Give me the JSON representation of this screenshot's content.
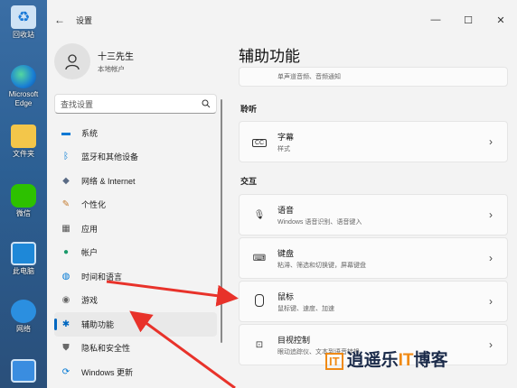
{
  "desktop": [
    {
      "label": "回收站",
      "icon": "recycle-bin-icon"
    },
    {
      "label": "Microsoft Edge",
      "icon": "edge-icon"
    },
    {
      "label": "文件夹",
      "icon": "folder-icon"
    },
    {
      "label": "微信",
      "icon": "wechat-icon"
    },
    {
      "label": "此电脑",
      "icon": "computer-icon"
    },
    {
      "label": "网络",
      "icon": "network-icon"
    }
  ],
  "window": {
    "back": "←",
    "title": "设置",
    "controls": [
      "—",
      "☐",
      "✕"
    ]
  },
  "user": {
    "name": "十三先生",
    "role": "本地帐户"
  },
  "search": {
    "placeholder": "查找设置"
  },
  "nav": [
    {
      "label": "系统",
      "icon": "monitor-icon",
      "color": "#0078d4"
    },
    {
      "label": "蓝牙和其他设备",
      "icon": "bluetooth-icon",
      "color": "#0078d4"
    },
    {
      "label": "网络 & Internet",
      "icon": "wifi-icon",
      "color": "#5a6b85"
    },
    {
      "label": "个性化",
      "icon": "brush-icon",
      "color": "#c47a2c"
    },
    {
      "label": "应用",
      "icon": "apps-icon",
      "color": "#555"
    },
    {
      "label": "帐户",
      "icon": "person-icon",
      "color": "#1a9a6a"
    },
    {
      "label": "时间和语言",
      "icon": "globe-clock-icon",
      "color": "#0078d4"
    },
    {
      "label": "游戏",
      "icon": "gamepad-icon",
      "color": "#666"
    },
    {
      "label": "辅助功能",
      "icon": "accessibility-icon",
      "color": "#0067c0",
      "active": true
    },
    {
      "label": "隐私和安全性",
      "icon": "shield-icon",
      "color": "#6a6a6a"
    },
    {
      "label": "Windows 更新",
      "icon": "update-icon",
      "color": "#0078d4"
    }
  ],
  "page": {
    "title": "辅助功能",
    "top_card": {
      "desc": "单声道音频、音频通知"
    },
    "sections": [
      {
        "title": "聆听",
        "cards": [
          {
            "title": "字幕",
            "desc": "样式",
            "icon": "cc-icon"
          }
        ]
      },
      {
        "title": "交互",
        "cards": [
          {
            "title": "语音",
            "desc": "Windows 语音识别、语音键入",
            "icon": "microphone-icon"
          },
          {
            "title": "键盘",
            "desc": "粘滞、筛选和切换键，屏幕键盘",
            "icon": "keyboard-icon"
          },
          {
            "title": "鼠标",
            "desc": "鼠标键、速度、加速",
            "icon": "mouse-icon"
          },
          {
            "title": "目视控制",
            "desc": "眼动追踪仪、文本到语音转换",
            "icon": "eye-control-icon"
          }
        ]
      }
    ]
  },
  "watermark": {
    "part1": "逍遥乐",
    "part2": "IT",
    "part3": "博客"
  },
  "colors": {
    "accent": "#0067c0",
    "arrow": "#e8322a"
  }
}
